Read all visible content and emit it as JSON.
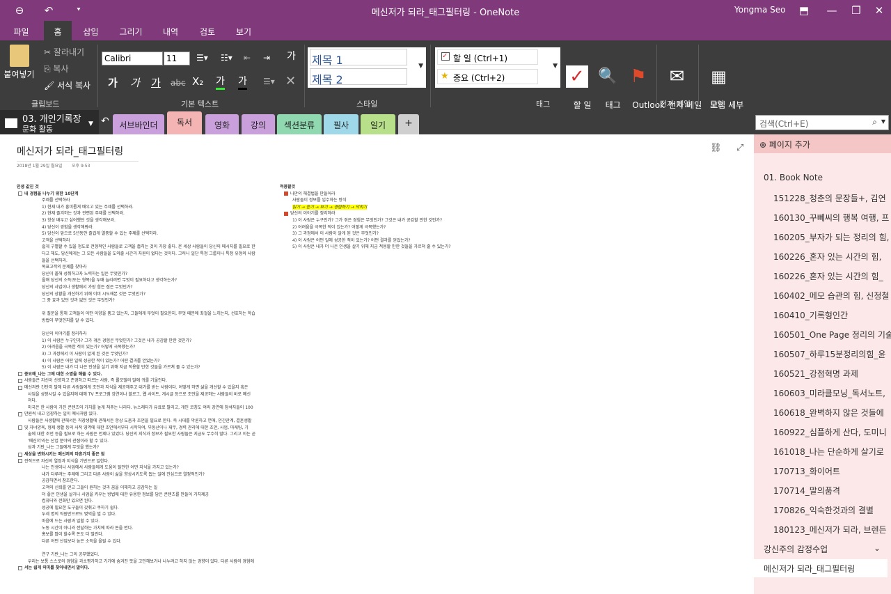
{
  "titlebar": {
    "back_icon": "back-arrow-icon",
    "undo_icon": "undo-icon",
    "customize": "⯆",
    "title": "메신저가 되라_태그필터링  -  OneNote",
    "user": "Yongma Seo",
    "colors": {
      "brand": "#80397b"
    }
  },
  "ribbon_tabs": [
    "파일",
    "홈",
    "삽입",
    "그리기",
    "내역",
    "검토",
    "보기"
  ],
  "ribbon": {
    "clipboard": {
      "paste": "붙여넣기",
      "cut": "잘라내기",
      "copy": "복사",
      "format_copy": "서식 복사",
      "label": "클립보드"
    },
    "basic": {
      "font": "Calibri",
      "size": "11",
      "bold": "가",
      "italic": "가",
      "underline": "가",
      "strike": "abc",
      "sub": "X₂",
      "hl": "가",
      "fc": "가",
      "label": "기본 텍스트",
      "clear": "가"
    },
    "styles": {
      "h1": "제목 1",
      "h2": "제목 2",
      "label": "스타일"
    },
    "tags": {
      "todo": "할 일 (Ctrl+1)",
      "important": "중요 (Ctrl+2)",
      "label": "태그",
      "todo_tag": "할 일\n태그",
      "find_tags": "태그\n찾기",
      "outlook": "Outlook\n작업",
      "email": "전자 메일\n로 보내기",
      "email_label": "전자 메일",
      "meeting": "모임 세부\n정보",
      "meeting_label": "모임"
    }
  },
  "notebook": {
    "name": "03. 개인기록장",
    "section": "문화 활동"
  },
  "sections": [
    {
      "label": "서브바인더",
      "color": "#c9a0dc"
    },
    {
      "label": "독서",
      "color": "#f4b4b4"
    },
    {
      "label": "영화",
      "color": "#c9a0dc"
    },
    {
      "label": "강의",
      "color": "#c9a0dc"
    },
    {
      "label": "섹션분류",
      "color": "#8fd8b0"
    },
    {
      "label": "필사",
      "color": "#9fd8e8"
    },
    {
      "label": "일기",
      "color": "#b8e08a"
    },
    {
      "label": "+",
      "color": "#cfcfcf"
    }
  ],
  "search": {
    "placeholder": "검색(Ctrl+E)"
  },
  "page": {
    "title": "메신저가 되라_태그필터링",
    "date": "2018년 1월 29일 월요일",
    "time": "오후 9:53"
  },
  "pages_pane": {
    "add": "페이지 추가",
    "items": [
      "01. Book Note",
      "151228_청춘의 문장들+, 김연",
      "160130_꾸뻬씨의 행복 여행, 프",
      "160205_부자가 되는 정리의 힘,",
      "160226_혼자 있는 시간의 힘,",
      "160226_혼자 있는 시간의 힘_",
      "160402_메모 습관의 힘, 신정철",
      "160410_기록형인간",
      "160501_One Page 정리의 기술",
      "160507_하루15분정리의힘_윤",
      "160521_강점혁명 과제",
      "160603_미라클모닝_독서노트,",
      "160618_완벽하지 않은 것들에",
      "160922_심플하게 산다, 도미니",
      "161018_나는 단순하게 살기로",
      "170713_화이어트",
      "170714_말의품격",
      "170826_익숙한것과의 결별",
      "180123_메신저가 되라, 브렌든",
      "강신주의 감정수업",
      "메신저가 되라_태그필터링"
    ]
  },
  "left_notes": [
    "인생 값진 것",
    "내 경험을 나누기 위한 10단계",
    "주제를 선택하라",
    "1) 현재 내가 흥미롭게 배우고 있는 주제를 선택하라.",
    "2) 현재 즐겨하는 것과 관련된 주제를 선택하라.",
    "3) 항상 배우고 싶어했던 것을 생각해보라.",
    "4) 당신이 경험을 생각해봐라.",
    "5) 당신이 앞으로 5년동안 즐겁게 열중할 수 있는 주제를 선택하라.",
    "고객을 선택하라",
    "쉽게 구별할 수 있을 정도로 전형적인 사람들로 고객을 좁히는 것이 가장 좋다. 온 세상 사람들이 당신의 메시지를 필요로 한",
    "다고 해도, 당신에게는 그 모든 사람들을 도와줄 시간과 자원이 없다는 것이다. 그러니 일단 특정 그룹이나 특정 유형의 사람",
    "들을 선택하라.",
    "목표고객의 문제를 찾아라",
    "당신이 올해 성취하고자 노력하는 일은 무엇인가?",
    "올해 당신의 소득(또는 형복)을 두배 늘리려면 무엇이 필요하다고 생각하는가?",
    "당신의 사업이나 생활에서 가장 힘든 점은 무엇인가?",
    "당신의 상황을 개선하기 위해 이미 시도해본 것은 무엇인가?",
    "그 중 효과 있던 것과 없던 것은 무엇인가?",
    "",
    "위 질문을 통해 고객들이 어떤 이양을 품고 있는지, 그들에게 무엇이 필요한지, 무엇 때문에 좌절을 느끼는지, 선호하는 학습",
    "방법이 무엇인지를 알 수 있다.",
    "",
    "당신의 이야기를 정리하라",
    "1) 이 사람은 누구인가? 그가 겪은 경험은 무엇인가? 그것은 내가 공감할 만한 것인가?",
    "2) 어려움을 극복한 적이 있는가? 어떻게 극복했는가?",
    "3) 그 과정에서 이 사람이 알게 된 것은 무엇인가?",
    "4) 이 사람은 어떤 일에 성공한 적이 있는가? 어떤 결과를 얻었는가?",
    "5) 이 사람은 내가 더 나은 인생을 살기 위해 지금 적용할 만한 것들을 가르쳐 줄 수 있는가?",
    "중요해_나는 그에 대한 소명을 해줄 수 있다.",
    "사람들은 자신이 신뢰하고 존경하고 따르는 사람, 즉 롤모델의 말에 귀를 기울인다.",
    "메신저란 간단히 말해 다른 사람들에게 조언과 지식을 제공해주고 대가를 받는 사람이다. 어떻게 하면 삶을 개선할 수 있을지 혹은",
    "사업을 성장시킬 수 있을지에 대해 TV 프로그램 강연이나 블로그, 웹 사이트, 게시글 등으로 조언을 제공하는 사람들이 바로 메신",
    "저다.",
    "미국은 한 사람이 가진 콘텐츠의 가치를 높게 쳐주는 나라다. 뉴스레터가 유료로 팔리고, 개인 코칭도 여러 강연에 참석자들이 100",
    "만원씩 내고 입장하는 일이 예사처럼 있다.",
    "사람들은 사생활에 관해서든 직장생활에 관해서든 항상 도움과 조언을 필요로 한다. 즉 시대를 막론하고 연애, 인간관계, 결혼생활",
    "및 자녀양육, 형제 생활 등의 사적 영역에 대한 조언에서부터 시작하여, 부동산이나 재무, 경력 관리에 대한 조언, 사업, 마케팅, 기",
    "술에 대한 조언 등을 필요로 하는 사람은 언제나 있었다. 당신의 지식과 정보가 필요한 사람들은 지금도 무수히 많다. 그리고 이는 곧",
    "'메신저'라는 산업 분야의 관점이라 할 수 있다.",
    "성과 기반_나는 그들에게 무엇을 했는가?",
    "세상을 변화시키는 메신저의 마흔가지 좋은 점",
    "전적으로 자신의 열정과 지식을 기반으로 일한다.",
    "나는 인생이나 사업에서 사람들에게 도움이 될만한 어떤 지식을 가지고 있는가?",
    "내가 다루려는 주제에 그리고 다른 사람이 삶을 향상시키도록 돕는 일에 진심으로 열정적인가?",
    "공감하면서 참조한다.",
    "고객의 신뢰를 얻고 그들이 원하는 것과 꿈을 이해하고 공감하는 일",
    "더 좋은 인생을 살거나 사업을 키우는 방법에 대한 유용한 정보를 담은 콘텐츠를 만들어 가치제공",
    "컴퓨터와 전화만 있으면 된다.",
    "성공에 필요한 도구들이 갖춰고 쿠하기 쉽다.",
    "두세 명의 직원만으로도 몇억을 벌 수 있다.",
    "마음에 드는 사람과 일할 수 있다.",
    "노동 시간이 아니라 전달하는 가치에 따라 돈을 번다.",
    "홍보를 많이 할수록 돈도 더 벌린다.",
    "다른 어떤 산업보다 높은 소득을 올릴 수 있다.",
    "",
    "연구 기반_나는 그의 공부했었다.",
    "우리는 보통 스스로의 경험을 과소평가하고 기가에 숨겨진 뜻을 고민해보거나 나누려고 하지 않는 경향이 있다. 다른 사람의 경험에",
    "서는 쉽게 의미를 찾아내면서 말이다."
  ],
  "right_notes": [
    "적용할것",
    "나만의 해결법을 만들어라",
    "사람들이 정보를 입수하는 방식",
    "읽기 → 듣기 → 보기 → 경험하기 → 익히기",
    "당신의 이야기를 정리하라",
    "1) 이 사람은 누구인가? 그가 겪은 경험은 무엇인가? 그것은 내가 공감할 만한 것인가?",
    "2) 어려움을 극복한 적이 있는가? 어떻게 극복했는가?",
    "3) 그 과정에서 이 사람이 알게 된 것은 무엇인가?",
    "4) 이 사람은 어떤 일에 성공한 적이 있는가? 어떤 결과를 얻었는가?",
    "5) 이 사람은 내가 더 나은 인생을 살기 위해 지금 적용할 만한 것들을 가르쳐 줄 수 있는가?"
  ]
}
